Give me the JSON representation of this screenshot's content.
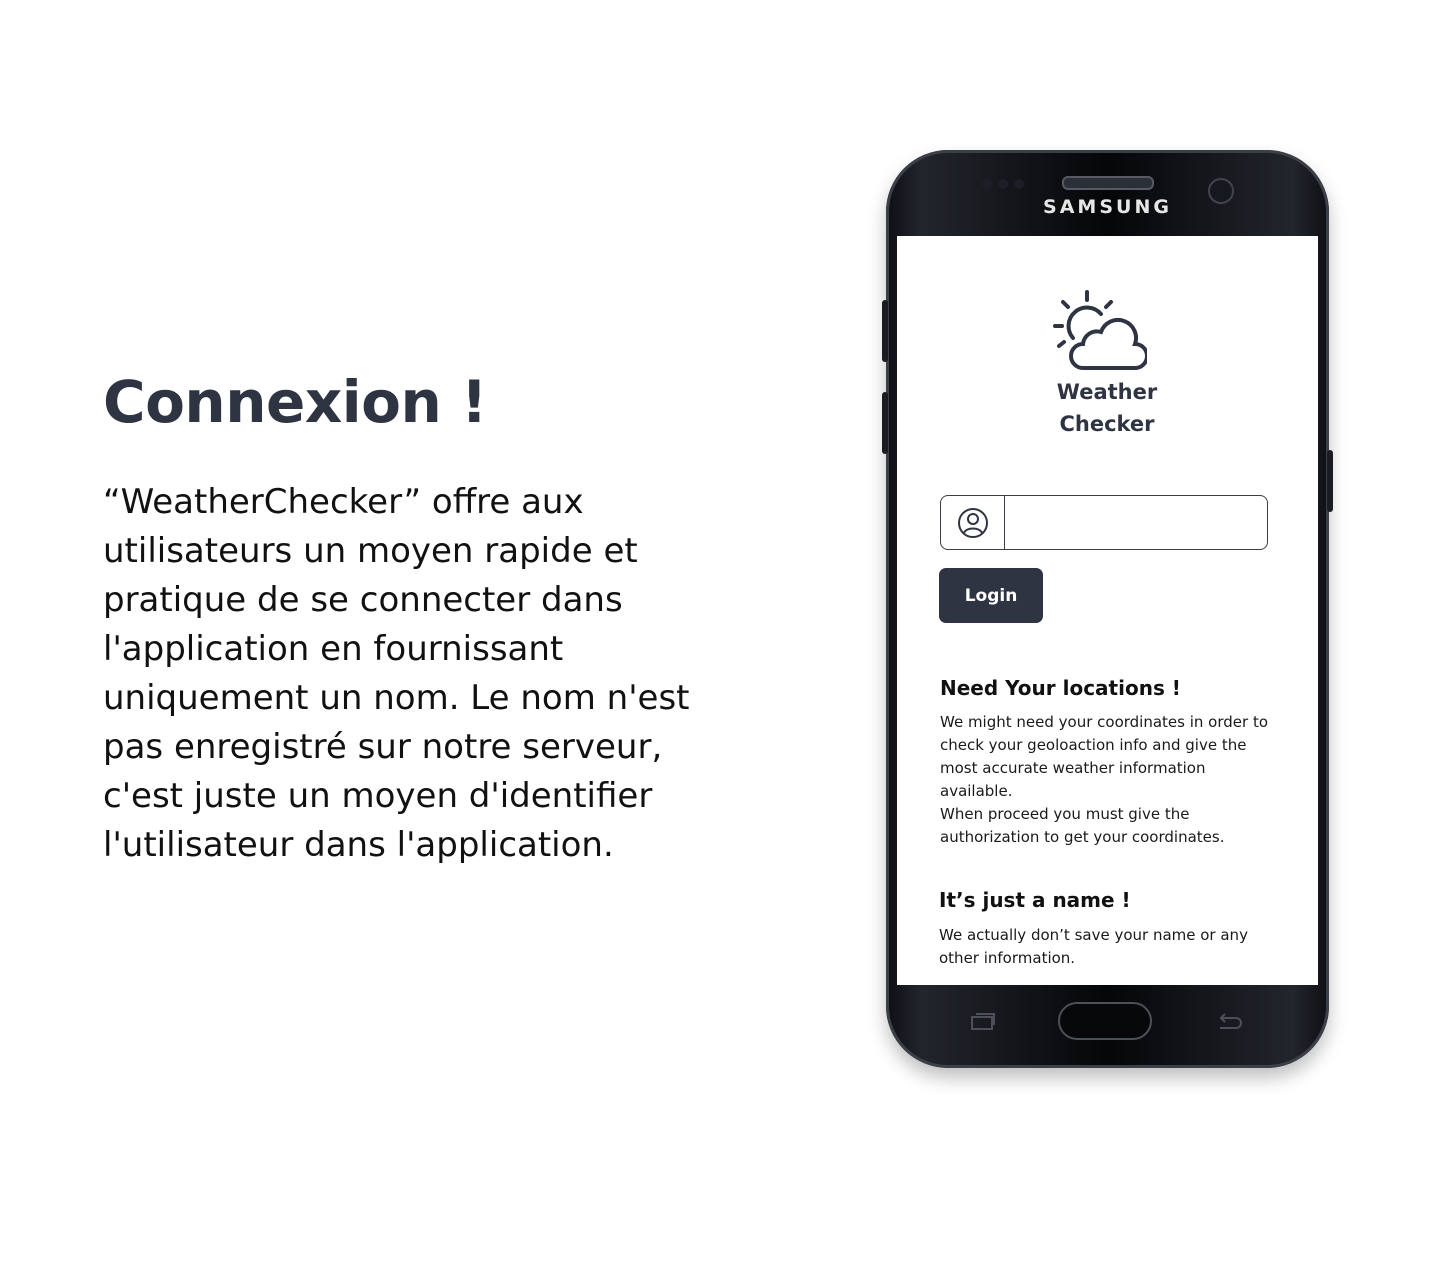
{
  "promo": {
    "title": "Connexion !",
    "description": "“WeatherChecker” offre aux utilisateurs un moyen rapide et pratique de se connecter dans l'application en fournissant uniquement un nom. Le nom n'est pas enregistré sur notre serveur, c'est juste un moyen d'identifier l'utilisateur dans l'application."
  },
  "device": {
    "brand": "SAMSUNG"
  },
  "app": {
    "logo_icon": "weather-sun-cloud-icon",
    "name_line1": "Weather",
    "name_line2": "Checker",
    "name_input": {
      "icon": "user-circle-icon",
      "value": "",
      "placeholder": ""
    },
    "login_label": "Login",
    "locations": {
      "heading": "Need Your locations !",
      "body_lines": [
        "We might need your coordinates in order to",
        "check your geoloaction info and give the",
        "most accurate weather information",
        "available.",
        "When proceed you must give the",
        "authorization to get your coordinates."
      ]
    },
    "name_notice": {
      "heading": "It’s just a name !",
      "body_lines": [
        "We actually don’t save your name or any",
        "other information."
      ]
    }
  },
  "colors": {
    "brand_dark": "#2f3443",
    "background": "#ffffff"
  }
}
